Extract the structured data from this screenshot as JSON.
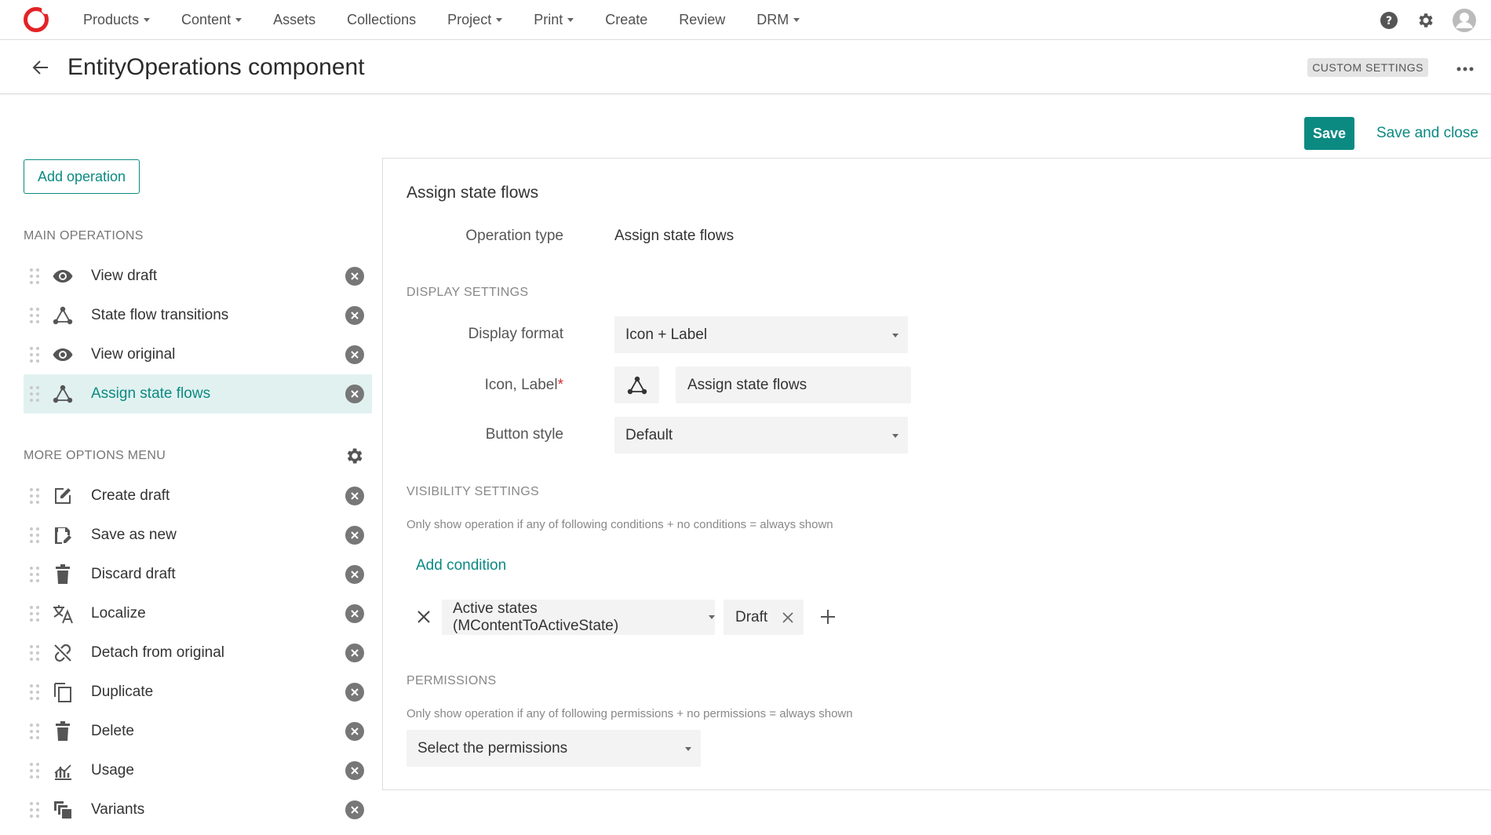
{
  "nav": {
    "items": [
      {
        "label": "Products",
        "caret": true
      },
      {
        "label": "Content",
        "caret": true
      },
      {
        "label": "Assets",
        "caret": false
      },
      {
        "label": "Collections",
        "caret": false
      },
      {
        "label": "Project",
        "caret": true
      },
      {
        "label": "Print",
        "caret": true
      },
      {
        "label": "Create",
        "caret": false
      },
      {
        "label": "Review",
        "caret": false
      },
      {
        "label": "DRM",
        "caret": true
      }
    ]
  },
  "header": {
    "title": "EntityOperations component",
    "badge": "CUSTOM SETTINGS"
  },
  "actions": {
    "save": "Save",
    "save_close": "Save and close"
  },
  "left": {
    "add_operation": "Add operation",
    "main_heading": "MAIN OPERATIONS",
    "main_items": [
      {
        "label": "View draft",
        "icon": "eye-icon"
      },
      {
        "label": "State flow transitions",
        "icon": "state-flow-icon"
      },
      {
        "label": "View original",
        "icon": "eye-icon"
      },
      {
        "label": "Assign state flows",
        "icon": "state-flow-icon",
        "active": true
      }
    ],
    "more_heading": "MORE OPTIONS MENU",
    "more_items": [
      {
        "label": "Create draft",
        "icon": "edit-icon"
      },
      {
        "label": "Save as new",
        "icon": "save-as-icon"
      },
      {
        "label": "Discard draft",
        "icon": "trash-icon"
      },
      {
        "label": "Localize",
        "icon": "translate-icon"
      },
      {
        "label": "Detach from original",
        "icon": "unlink-icon"
      },
      {
        "label": "Duplicate",
        "icon": "copy-icon"
      },
      {
        "label": "Delete",
        "icon": "trash-icon"
      },
      {
        "label": "Usage",
        "icon": "usage-icon"
      },
      {
        "label": "Variants",
        "icon": "variants-icon"
      }
    ]
  },
  "panel": {
    "title": "Assign state flows",
    "operation_type_label": "Operation type",
    "operation_type_value": "Assign state flows",
    "display_heading": "DISPLAY SETTINGS",
    "display_format_label": "Display format",
    "display_format_value": "Icon + Label",
    "icon_label_label": "Icon, Label",
    "required_mark": "*",
    "label_value": "Assign state flows",
    "button_style_label": "Button style",
    "button_style_value": "Default",
    "visibility_heading": "VISIBILITY SETTINGS",
    "visibility_help": "Only show operation if any of following conditions + no conditions = always shown",
    "add_condition": "Add condition",
    "condition_field": "Active states (MContentToActiveState)",
    "condition_value": "Draft",
    "permissions_heading": "PERMISSIONS",
    "permissions_help": "Only show operation if any of following permissions + no permissions = always shown",
    "permissions_placeholder": "Select the permissions"
  },
  "colors": {
    "accent": "#0b8a82",
    "brand": "#e32326"
  }
}
